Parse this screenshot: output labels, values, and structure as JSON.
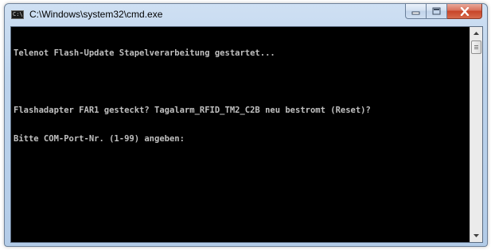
{
  "window": {
    "title": "C:\\Windows\\system32\\cmd.exe",
    "icon": "cmd-icon",
    "icon_text": "C:\\"
  },
  "controls": {
    "minimize_icon": "minimize-icon",
    "maximize_icon": "maximize-icon",
    "close_icon": "close-icon"
  },
  "console": {
    "background": "#000000",
    "foreground": "#c0c0c0",
    "lines": [
      "Telenot Flash-Update Stapelverarbeitung gestartet...",
      "",
      "Flashadapter FAR1 gesteckt? Tagalarm_RFID_TM2_C2B neu bestromt (Reset)?",
      "Bitte COM-Port-Nr. (1-99) angeben:"
    ]
  },
  "scrollbar": {
    "up_icon": "scroll-up-arrow-icon",
    "down_icon": "scroll-down-arrow-icon"
  }
}
